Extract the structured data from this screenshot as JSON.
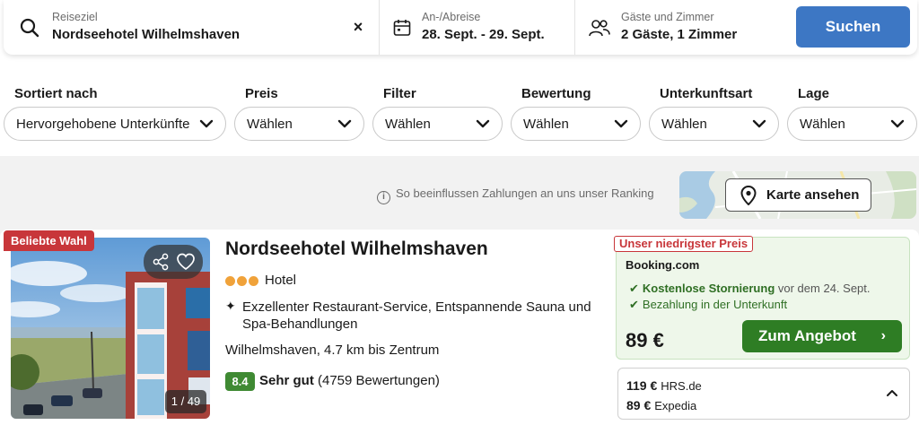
{
  "search": {
    "destination_label": "Reiseziel",
    "destination_value": "Nordseehotel Wilhelmshaven",
    "dates_label": "An-/Abreise",
    "dates_value": "28. Sept. - 29. Sept.",
    "guests_label": "Gäste und Zimmer",
    "guests_value": "2 Gäste, 1 Zimmer",
    "search_button": "Suchen",
    "clear_icon": "×",
    "icons": [
      "search-icon",
      "calendar-icon",
      "guests-icon",
      "close-icon"
    ]
  },
  "filters": [
    {
      "title": "Sortiert nach",
      "value": "Hervorgehobene Unterkünfte"
    },
    {
      "title": "Preis",
      "value": "Wählen"
    },
    {
      "title": "Filter",
      "value": "Wählen"
    },
    {
      "title": "Bewertung",
      "value": "Wählen"
    },
    {
      "title": "Unterkunftsart",
      "value": "Wählen"
    },
    {
      "title": "Lage",
      "value": "Wählen"
    }
  ],
  "ranking_info": "So beeinflussen Zahlungen an uns unser Ranking",
  "map": {
    "button_label": "Karte ansehen"
  },
  "hotel": {
    "badge": "Beliebte Wahl",
    "name": "Nordseehotel Wilhelmshaven",
    "star_count": 3,
    "type": "Hotel",
    "feature": "Exzellenter Restaurant-Service, Entspannende Sauna und Spa-Behandlungen",
    "location": "Wilhelmshaven, 4.7 km bis Zentrum",
    "score": "8.4",
    "score_word": "Sehr gut",
    "reviews": "(4759 Bewertungen)",
    "photo_counter": "1 / 49"
  },
  "offer": {
    "badge": "Unser niedrigster Preis",
    "provider": "Booking.com",
    "line1_bold": "Kostenlose Stornierung",
    "line1_rest": "vor dem 24. Sept.",
    "line2": "Bezahlung in der Unterkunft",
    "price": "89 €",
    "button": "Zum Angebot",
    "button_arrow": "›"
  },
  "other_offers": [
    {
      "price": "119 €",
      "provider": "HRS.de"
    },
    {
      "price": "89 €",
      "provider": "Expedia"
    }
  ],
  "colors": {
    "primary_blue": "#3d77c4",
    "deal_green": "#2e7d24",
    "score_green": "#3f8a33",
    "badge_red": "#c8363a",
    "star_orange": "#f0a23a",
    "offer_bg": "#eef7ea"
  }
}
